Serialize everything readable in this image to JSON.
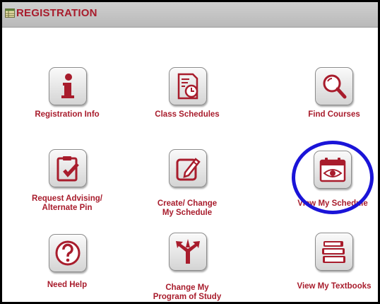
{
  "header": {
    "title": "REGISTRATION"
  },
  "tiles": {
    "registration_info": {
      "label": "Registration Info"
    },
    "class_schedules": {
      "label": "Class Schedules"
    },
    "find_courses": {
      "label": "Find Courses"
    },
    "request_advising": {
      "label1": "Request Advising/",
      "label2": "Alternate Pin"
    },
    "create_change": {
      "label1": "Create/ Change",
      "label2": "My Schedule"
    },
    "view_schedule": {
      "label": "View My Schedule"
    },
    "need_help": {
      "label": "Need Help"
    },
    "change_program": {
      "label1": "Change My",
      "label2": "Program of Study"
    },
    "view_textbooks": {
      "label": "View My Textbooks"
    }
  },
  "colors": {
    "accent": "#a81c2c",
    "highlight_circle": "#1a14d8",
    "header_bg": "#c4c4c4"
  },
  "icons": [
    "info-icon",
    "clock-document-icon",
    "magnifier-icon",
    "clipboard-check-icon",
    "pencil-edit-icon",
    "calendar-eye-icon",
    "question-icon",
    "branching-arrows-icon",
    "books-icon"
  ]
}
